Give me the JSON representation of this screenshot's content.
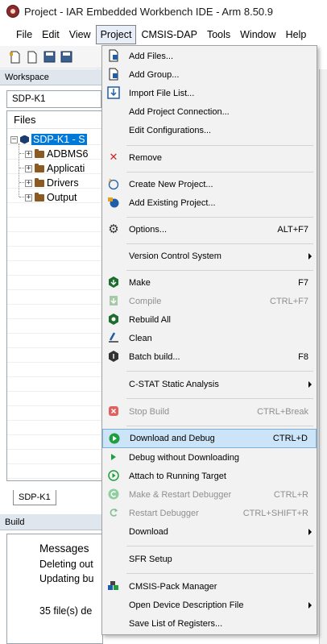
{
  "window": {
    "title": "Project - IAR Embedded Workbench IDE - Arm 8.50.9"
  },
  "menubar": {
    "items": [
      "File",
      "Edit",
      "View",
      "Project",
      "CMSIS-DAP",
      "Tools",
      "Window",
      "Help"
    ]
  },
  "workspace": {
    "header": "Workspace",
    "config_selector": "SDP-K1",
    "files_header": "Files",
    "tree": [
      {
        "label": "SDP-K1 - S"
      },
      {
        "label": "ADBMS6"
      },
      {
        "label": "Applicati"
      },
      {
        "label": "Drivers"
      },
      {
        "label": "Output"
      }
    ],
    "tab": "SDP-K1"
  },
  "build": {
    "header": "Build",
    "messages_header": "Messages",
    "lines": [
      "Deleting out",
      "Updating bu",
      "35 file(s) de"
    ]
  },
  "project_menu": {
    "items": [
      {
        "label": "Add Files...",
        "shortcut": "",
        "icon": "add-files-icon"
      },
      {
        "label": "Add Group...",
        "shortcut": "",
        "icon": "add-group-icon"
      },
      {
        "label": "Import File List...",
        "shortcut": "",
        "icon": "import-icon"
      },
      {
        "label": "Add Project Connection...",
        "shortcut": "",
        "icon": ""
      },
      {
        "label": "Edit Configurations...",
        "shortcut": "",
        "icon": ""
      },
      {
        "label": "Remove",
        "shortcut": "",
        "icon": "remove-icon"
      },
      {
        "label": "Create New Project...",
        "shortcut": "",
        "icon": "new-project-icon"
      },
      {
        "label": "Add Existing Project...",
        "shortcut": "",
        "icon": "existing-project-icon"
      },
      {
        "label": "Options...",
        "shortcut": "ALT+F7",
        "icon": "gear-icon"
      },
      {
        "label": "Version Control System",
        "shortcut": "",
        "icon": ""
      },
      {
        "label": "Make",
        "shortcut": "F7",
        "icon": "make-icon"
      },
      {
        "label": "Compile",
        "shortcut": "CTRL+F7",
        "icon": "compile-icon"
      },
      {
        "label": "Rebuild All",
        "shortcut": "",
        "icon": "rebuild-icon"
      },
      {
        "label": "Clean",
        "shortcut": "",
        "icon": "clean-icon"
      },
      {
        "label": "Batch build...",
        "shortcut": "F8",
        "icon": "batch-build-icon"
      },
      {
        "label": "C-STAT Static Analysis",
        "shortcut": "",
        "icon": ""
      },
      {
        "label": "Stop Build",
        "shortcut": "CTRL+Break",
        "icon": "stop-icon"
      },
      {
        "label": "Download and Debug",
        "shortcut": "CTRL+D",
        "icon": "play-icon"
      },
      {
        "label": "Debug without Downloading",
        "shortcut": "",
        "icon": "play-small-icon"
      },
      {
        "label": "Attach to Running Target",
        "shortcut": "",
        "icon": "attach-icon"
      },
      {
        "label": "Make & Restart Debugger",
        "shortcut": "CTRL+R",
        "icon": "make-restart-icon"
      },
      {
        "label": "Restart Debugger",
        "shortcut": "CTRL+SHIFT+R",
        "icon": "restart-icon"
      },
      {
        "label": "Download",
        "shortcut": "",
        "icon": ""
      },
      {
        "label": "SFR Setup",
        "shortcut": "",
        "icon": ""
      },
      {
        "label": "CMSIS-Pack Manager",
        "shortcut": "",
        "icon": "pack-manager-icon"
      },
      {
        "label": "Open Device Description File",
        "shortcut": "",
        "icon": ""
      },
      {
        "label": "Save List of Registers...",
        "shortcut": "",
        "icon": ""
      }
    ]
  },
  "colors": {
    "selection_blue": "#0078d7",
    "menu_highlight": "#cce4f7",
    "remove_red": "#d42020",
    "run_green": "#1e9e3e"
  }
}
